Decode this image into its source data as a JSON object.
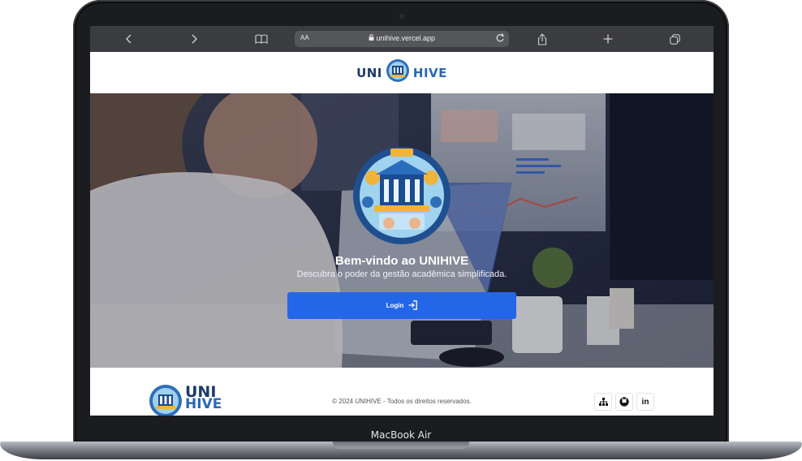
{
  "browser": {
    "back_icon": "chevron-left-icon",
    "forward_icon": "chevron-right-icon",
    "bookmarks_icon": "book-icon",
    "text_size_label": "AA",
    "url": "unihive.vercel.app",
    "lock_icon": "lock-icon",
    "reload_icon": "reload-icon",
    "share_icon": "share-icon",
    "new_tab_icon": "plus-icon",
    "tabs_icon": "tabs-icon"
  },
  "header": {
    "logo_left": "UNI",
    "logo_right": "HIVE"
  },
  "hero": {
    "title": "Bem-vindo ao UNIHIVE",
    "subtitle": "Descubra o poder da gestão acadêmica simplificada.",
    "login_label": "Login"
  },
  "footer": {
    "logo_top": "UNI",
    "logo_bottom": "HIVE",
    "copyright": "© 2024 UNIHIVE - Todos os direitos reservados.",
    "socials": [
      "sitemap-icon",
      "github-icon",
      "linkedin-icon"
    ],
    "linkedin_label": "in"
  },
  "device": {
    "label": "MacBook Air"
  },
  "colors": {
    "accent": "#2466e8",
    "brand_dark": "#1c3a6b",
    "brand_light": "#2b67b5"
  }
}
